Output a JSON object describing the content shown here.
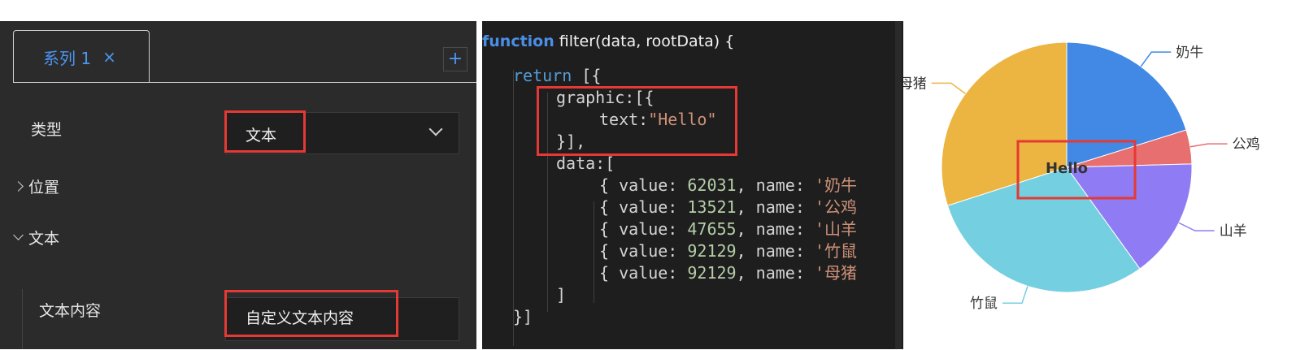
{
  "settings_panel": {
    "tab": {
      "label": "系列 1",
      "close": "×"
    },
    "add_button": "+",
    "type_row": {
      "label": "类型",
      "value": "文本"
    },
    "position_section": "位置",
    "text_section": "文本",
    "text_content_row": {
      "label": "文本内容",
      "value": "自定义文本内容"
    }
  },
  "code_editor": {
    "header_keyword": "function",
    "header_rest": " filter(data, rootData) {",
    "lines": [
      [
        {
          "t": "kw",
          "v": "return"
        },
        {
          "t": "p",
          "v": " [{"
        }
      ],
      [
        {
          "t": "p",
          "v": "graphic:[{"
        }
      ],
      [
        {
          "t": "p",
          "v": "text:"
        },
        {
          "t": "str",
          "v": "\"Hello\""
        }
      ],
      [
        {
          "t": "p",
          "v": "}],"
        }
      ],
      [
        {
          "t": "p",
          "v": "data:["
        }
      ],
      [
        {
          "t": "p",
          "v": "{ value: "
        },
        {
          "t": "num",
          "v": "62031"
        },
        {
          "t": "p",
          "v": ", name: "
        },
        {
          "t": "str",
          "v": "'奶牛"
        }
      ],
      [
        {
          "t": "p",
          "v": "{ value: "
        },
        {
          "t": "num",
          "v": "13521"
        },
        {
          "t": "p",
          "v": ", name: "
        },
        {
          "t": "str",
          "v": "'公鸡"
        }
      ],
      [
        {
          "t": "p",
          "v": "{ value: "
        },
        {
          "t": "num",
          "v": "47655"
        },
        {
          "t": "p",
          "v": ", name: "
        },
        {
          "t": "str",
          "v": "'山羊"
        }
      ],
      [
        {
          "t": "p",
          "v": "{ value: "
        },
        {
          "t": "num",
          "v": "92129"
        },
        {
          "t": "p",
          "v": ", name: "
        },
        {
          "t": "str",
          "v": "'竹鼠"
        }
      ],
      [
        {
          "t": "p",
          "v": "{ value: "
        },
        {
          "t": "num",
          "v": "92129"
        },
        {
          "t": "p",
          "v": ", name: "
        },
        {
          "t": "str",
          "v": "'母猪"
        }
      ],
      [
        {
          "t": "p",
          "v": "]"
        }
      ],
      [
        {
          "t": "p",
          "v": "}]"
        }
      ]
    ]
  },
  "chart_data": {
    "type": "pie",
    "center_text": "Hello",
    "slices": [
      {
        "name": "奶牛",
        "value": 62031,
        "color": "#4189e5"
      },
      {
        "name": "公鸡",
        "value": 13521,
        "color": "#e76f6f"
      },
      {
        "name": "山羊",
        "value": 47655,
        "color": "#8f7bf3"
      },
      {
        "name": "竹鼠",
        "value": 92129,
        "color": "#74cfe0"
      },
      {
        "name": "母猪",
        "value": 92129,
        "color": "#ecb441"
      }
    ]
  },
  "colors": {
    "accent": "#4d95f3",
    "highlight": "#e53935",
    "panel_bg": "#2b2b2b",
    "editor_bg": "#1e1e1e"
  }
}
